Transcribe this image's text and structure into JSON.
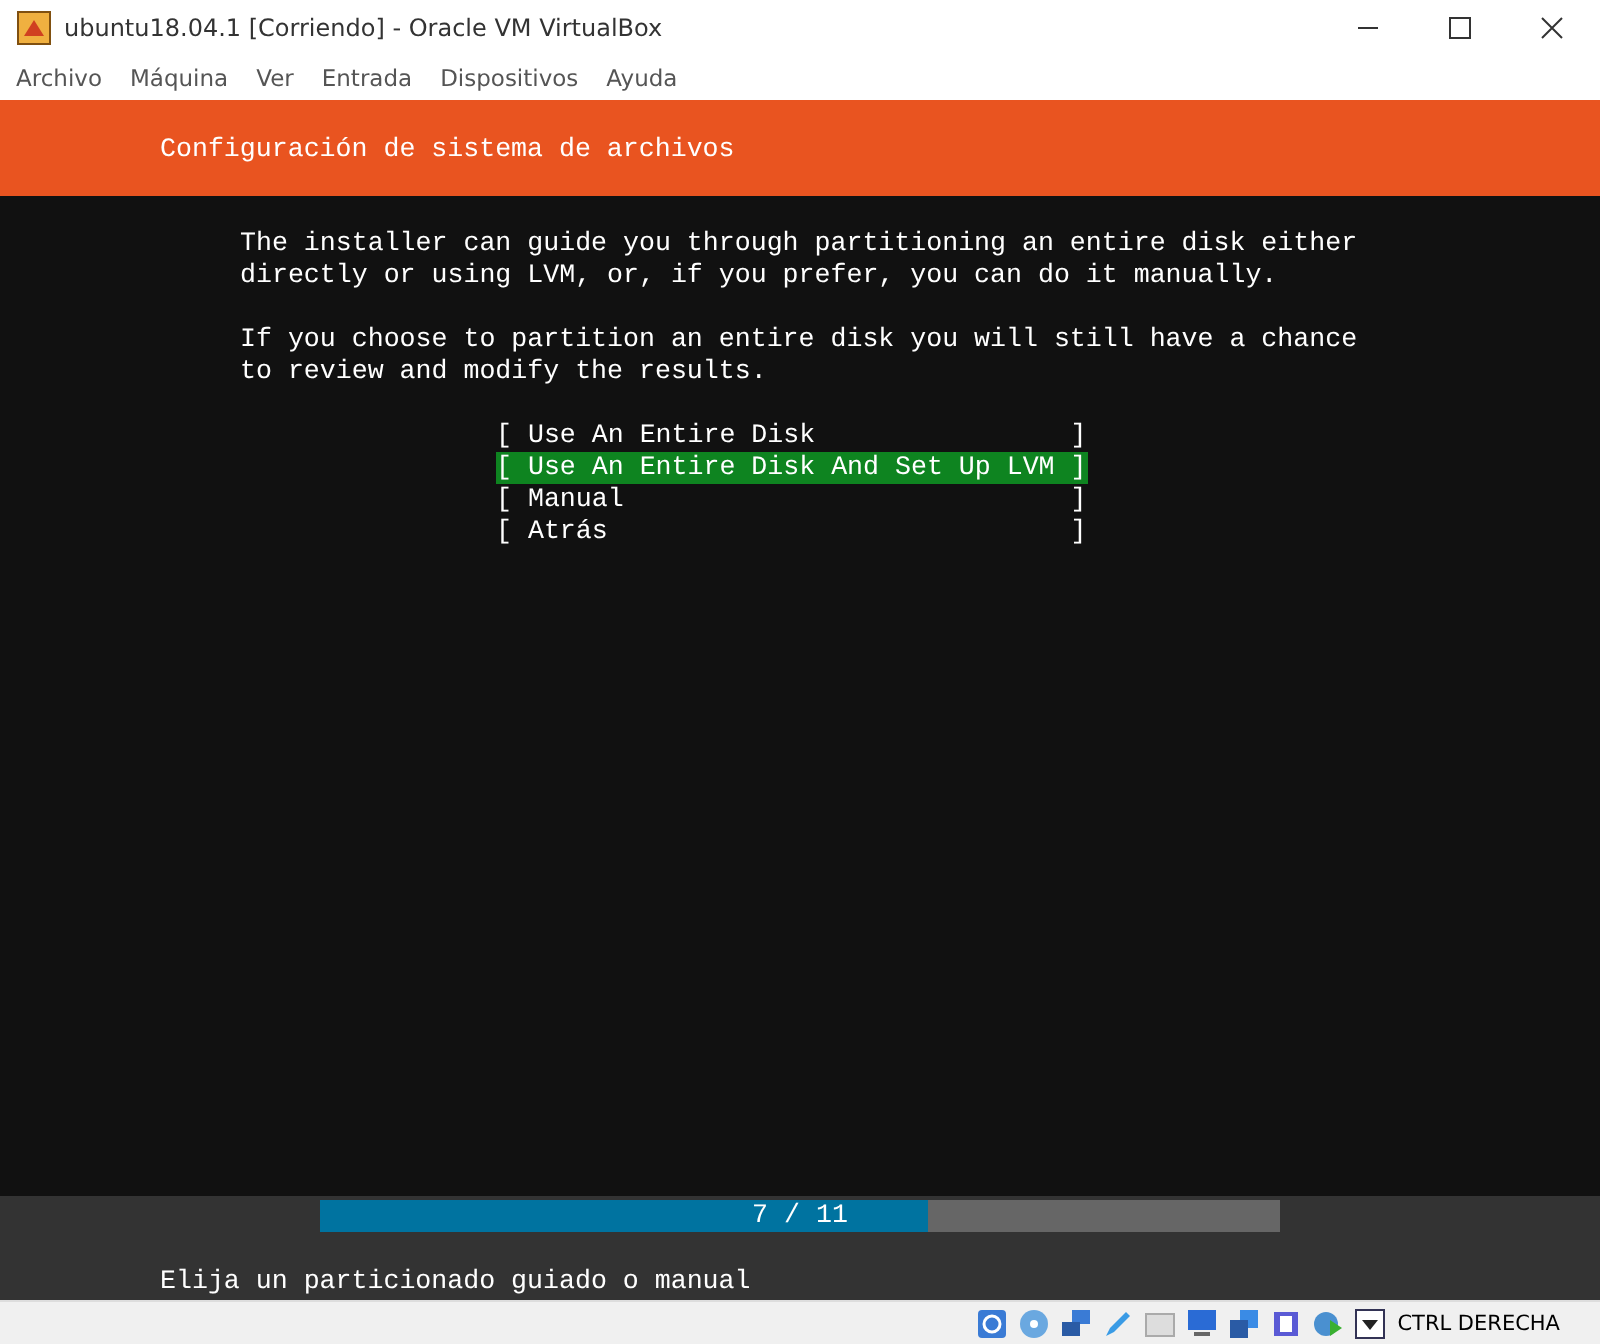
{
  "window": {
    "title": "ubuntu18.04.1 [Corriendo] - Oracle VM VirtualBox"
  },
  "menu": [
    "Archivo",
    "Máquina",
    "Ver",
    "Entrada",
    "Dispositivos",
    "Ayuda"
  ],
  "header": {
    "title": "Configuración de sistema de archivos"
  },
  "paragraphs": [
    "The installer can guide you through partitioning an entire disk either directly or using LVM, or, if you prefer, you can do it manually.",
    "If you choose to partition an entire disk you will still have a chance to review and modify the results."
  ],
  "options": [
    {
      "label": "[ Use An Entire Disk                ]",
      "selected": false
    },
    {
      "label": "[ Use An Entire Disk And Set Up LVM ]",
      "selected": true
    },
    {
      "label": "[ Manual                            ]",
      "selected": false
    },
    {
      "label": "[ Atrás                             ]",
      "selected": false
    }
  ],
  "progress": {
    "text": "7 / 11",
    "level": 0.633
  },
  "status": "Elija un particionado guiado o manual",
  "status_bar": {
    "host_key": "CTRL DERECHA"
  }
}
